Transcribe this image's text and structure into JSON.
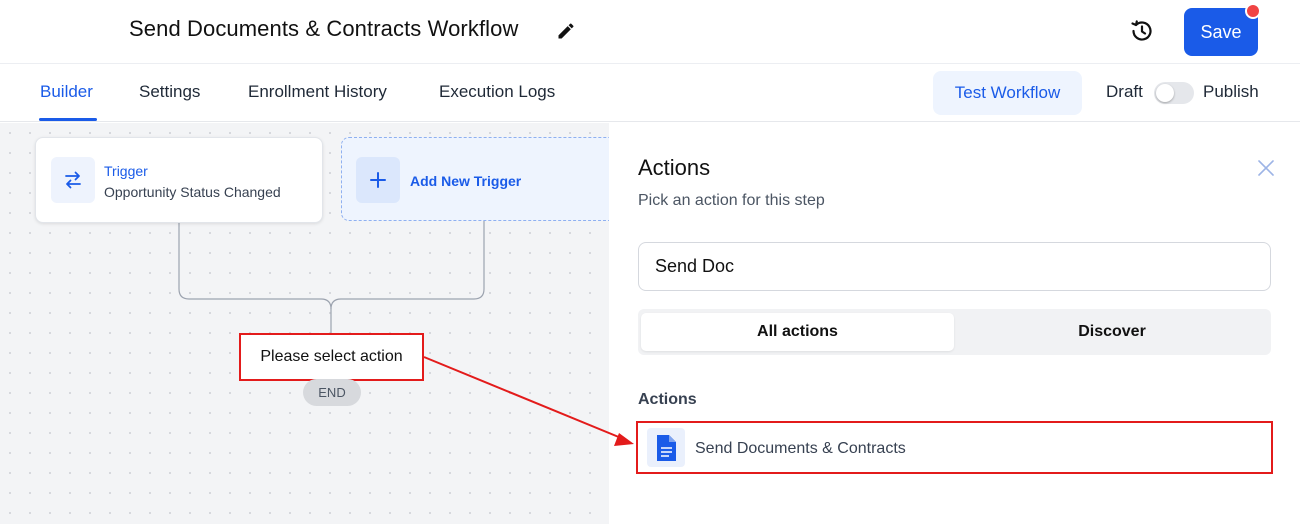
{
  "header": {
    "title": "Send Documents & Contracts Workflow",
    "save_label": "Save"
  },
  "tabs": [
    {
      "label": "Builder",
      "active": true
    },
    {
      "label": "Settings",
      "active": false
    },
    {
      "label": "Enrollment History",
      "active": false
    },
    {
      "label": "Execution Logs",
      "active": false
    }
  ],
  "toolbar": {
    "test_label": "Test Workflow",
    "draft_label": "Draft",
    "publish_label": "Publish",
    "publish_toggle_on": false
  },
  "canvas": {
    "trigger": {
      "title": "Trigger",
      "subtitle": "Opportunity Status Changed",
      "icon": "swap-arrows-icon"
    },
    "add_trigger": {
      "label": "Add New Trigger",
      "icon": "plus-icon"
    },
    "placeholder_action": "Please select action",
    "end_label": "END"
  },
  "panel": {
    "title": "Actions",
    "subtitle": "Pick an action for this step",
    "search_value": "Send Doc",
    "segments": [
      {
        "label": "All actions",
        "active": true
      },
      {
        "label": "Discover",
        "active": false
      }
    ],
    "section_label": "Actions",
    "results": [
      {
        "label": "Send Documents & Contracts",
        "icon": "document-icon"
      }
    ]
  },
  "colors": {
    "accent": "#1a5be8",
    "highlight": "#e31b1b",
    "notification": "#f04444"
  }
}
